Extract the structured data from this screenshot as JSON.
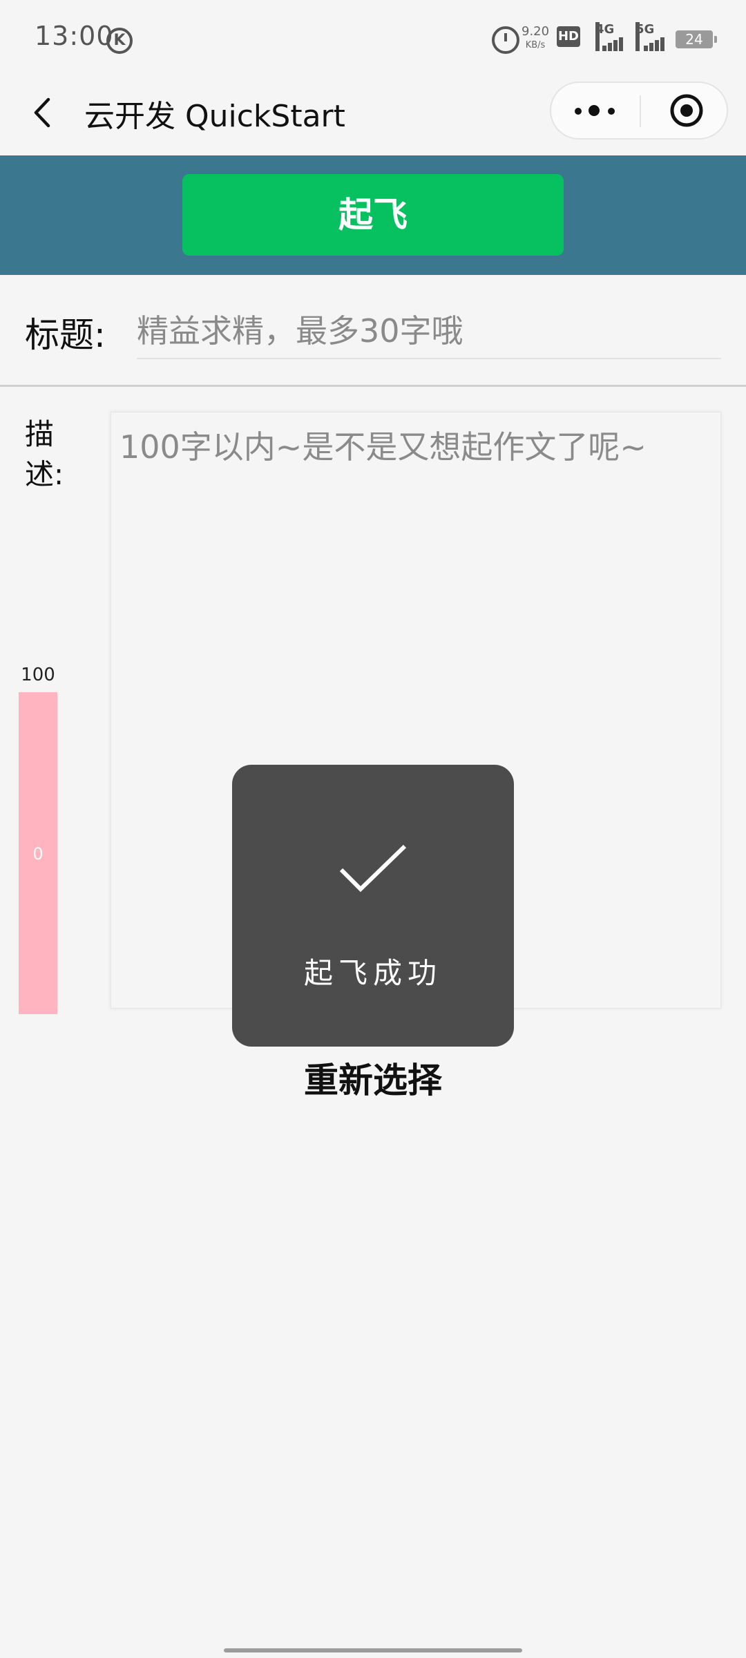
{
  "status_bar": {
    "time": "13:00",
    "k_badge": "K",
    "net_speed_value": "9.20",
    "net_speed_unit": "KB/s",
    "hd_label": "HD",
    "sim1_label": "4G",
    "sim2_label": "5G",
    "battery": "24"
  },
  "nav": {
    "title": "云开发 QuickStart"
  },
  "hero": {
    "takeoff_label": "起飞"
  },
  "form": {
    "title_label": "标题:",
    "title_placeholder": "精益求精，最多30字哦",
    "title_value": "",
    "desc_label": "描述:",
    "desc_placeholder": "100字以内~是不是又想起作文了呢~",
    "desc_value": ""
  },
  "counter": {
    "max": "100",
    "value": "0"
  },
  "toast": {
    "text": "起飞成功",
    "icon": "check-icon"
  },
  "actions": {
    "reselect_label": "重新选择"
  },
  "colors": {
    "hero_bg": "#3b7890",
    "primary_green": "#07c160",
    "counter_pink": "#ffb4c0",
    "toast_bg": "#4c4c4c"
  }
}
